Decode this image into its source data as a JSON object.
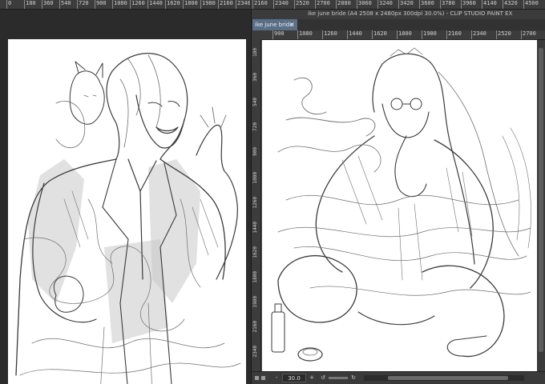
{
  "left_ruler": {
    "ticks": [
      "0",
      "180",
      "360",
      "540",
      "720",
      "900",
      "1080",
      "1260",
      "1440",
      "1620",
      "1800",
      "1980",
      "2160",
      "2340"
    ]
  },
  "right_ruler_top": {
    "ticks": [
      "2160",
      "2340",
      "2520",
      "2700",
      "2880",
      "3060",
      "3240",
      "3420",
      "3600",
      "3780",
      "3960",
      "4140",
      "4320",
      "4500"
    ],
    "display": [
      "240",
      "420",
      "600",
      "780",
      "960",
      "1140",
      "1320",
      "1500",
      "1680",
      "1860",
      "2040",
      "2220",
      "2400",
      "2580",
      "2760",
      "2940",
      "3120",
      "3300",
      "3480",
      "3660",
      "3840",
      "4020",
      "4200",
      "4400",
      "4460"
    ]
  },
  "window": {
    "title": "ike june bride (A4 2508 x 2480px 300dpi 30.0%)  - CLIP STUDIO PAINT EX",
    "tab_label": "ike june bride",
    "tab_close": "×"
  },
  "inner_ruler_h": {
    "ticks": [
      "900",
      "1080",
      "1260",
      "1440",
      "1620",
      "1800",
      "1980",
      "2160",
      "2340",
      "2520",
      "2700"
    ],
    "first_label": "|900"
  },
  "inner_ruler_v": {
    "ticks": [
      "180",
      "360",
      "540",
      "720",
      "900",
      "1080",
      "1260",
      "1440",
      "1620",
      "1800",
      "1980",
      "2160",
      "2340"
    ]
  },
  "statusbar": {
    "zoom_value": "30.0",
    "zoom_out_label": "-",
    "zoom_in_label": "+",
    "rotate_left_icon": "rotate-left-icon",
    "rotate_right_icon": "rotate-right-icon"
  },
  "colors": {
    "app_bg": "#2b2b2b",
    "ruler_bg": "#3c3c3c",
    "tab_active": "#5a6f86",
    "canvas": "#ffffff",
    "sketch_stroke": "#3a3a3a"
  }
}
